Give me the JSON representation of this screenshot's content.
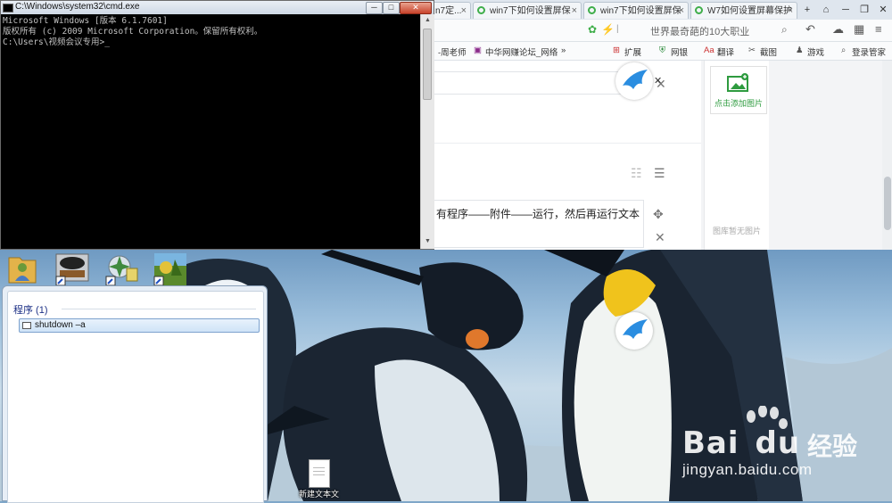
{
  "cmd": {
    "title": "C:\\Windows\\system32\\cmd.exe",
    "lines": [
      "Microsoft Windows [版本 6.1.7601]",
      "版权所有 (c) 2009 Microsoft Corporation。保留所有权利。",
      "",
      "C:\\Users\\视频会议专用>_"
    ],
    "min_label": "─",
    "max_label": "□",
    "close_label": "✕"
  },
  "browser": {
    "tabs": [
      {
        "label": "n7定..."
      },
      {
        "label": "win7下如何设置屏保"
      },
      {
        "label": "win7下如何设置屏保"
      },
      {
        "label": "W7如何设置屏幕保护"
      }
    ],
    "new_tab_label": "+",
    "search_hint": "世界最奇葩的10大职业",
    "bookmarks": [
      {
        "label": "-周老师"
      },
      {
        "label": "中华网赚论坛_网络"
      },
      {
        "label": "»"
      },
      {
        "label": "扩展"
      },
      {
        "label": "网银"
      },
      {
        "label": "翻译"
      },
      {
        "label": "截图"
      },
      {
        "label": "游戏"
      },
      {
        "label": "登录管家"
      }
    ],
    "editor_step_text": "有程序——附件——运行，然后再运行文本",
    "add_image_label": "点击添加图片",
    "no_image_label": "图库暂无图片"
  },
  "start_panel": {
    "section_header": "程序 (1)",
    "result_label": "shutdown –a"
  },
  "desktop": {
    "file_label": "新建文本文",
    "watermark_brand": "Bai",
    "watermark_brand2": "du",
    "watermark_jingyan": "经验",
    "watermark_url": "jingyan.baidu.com"
  },
  "colors": {
    "cmd_bg": "#000000",
    "cmd_text": "#c0c0c0",
    "tab_accent": "#3fae4a",
    "add_image_green": "#2e9b3f"
  }
}
